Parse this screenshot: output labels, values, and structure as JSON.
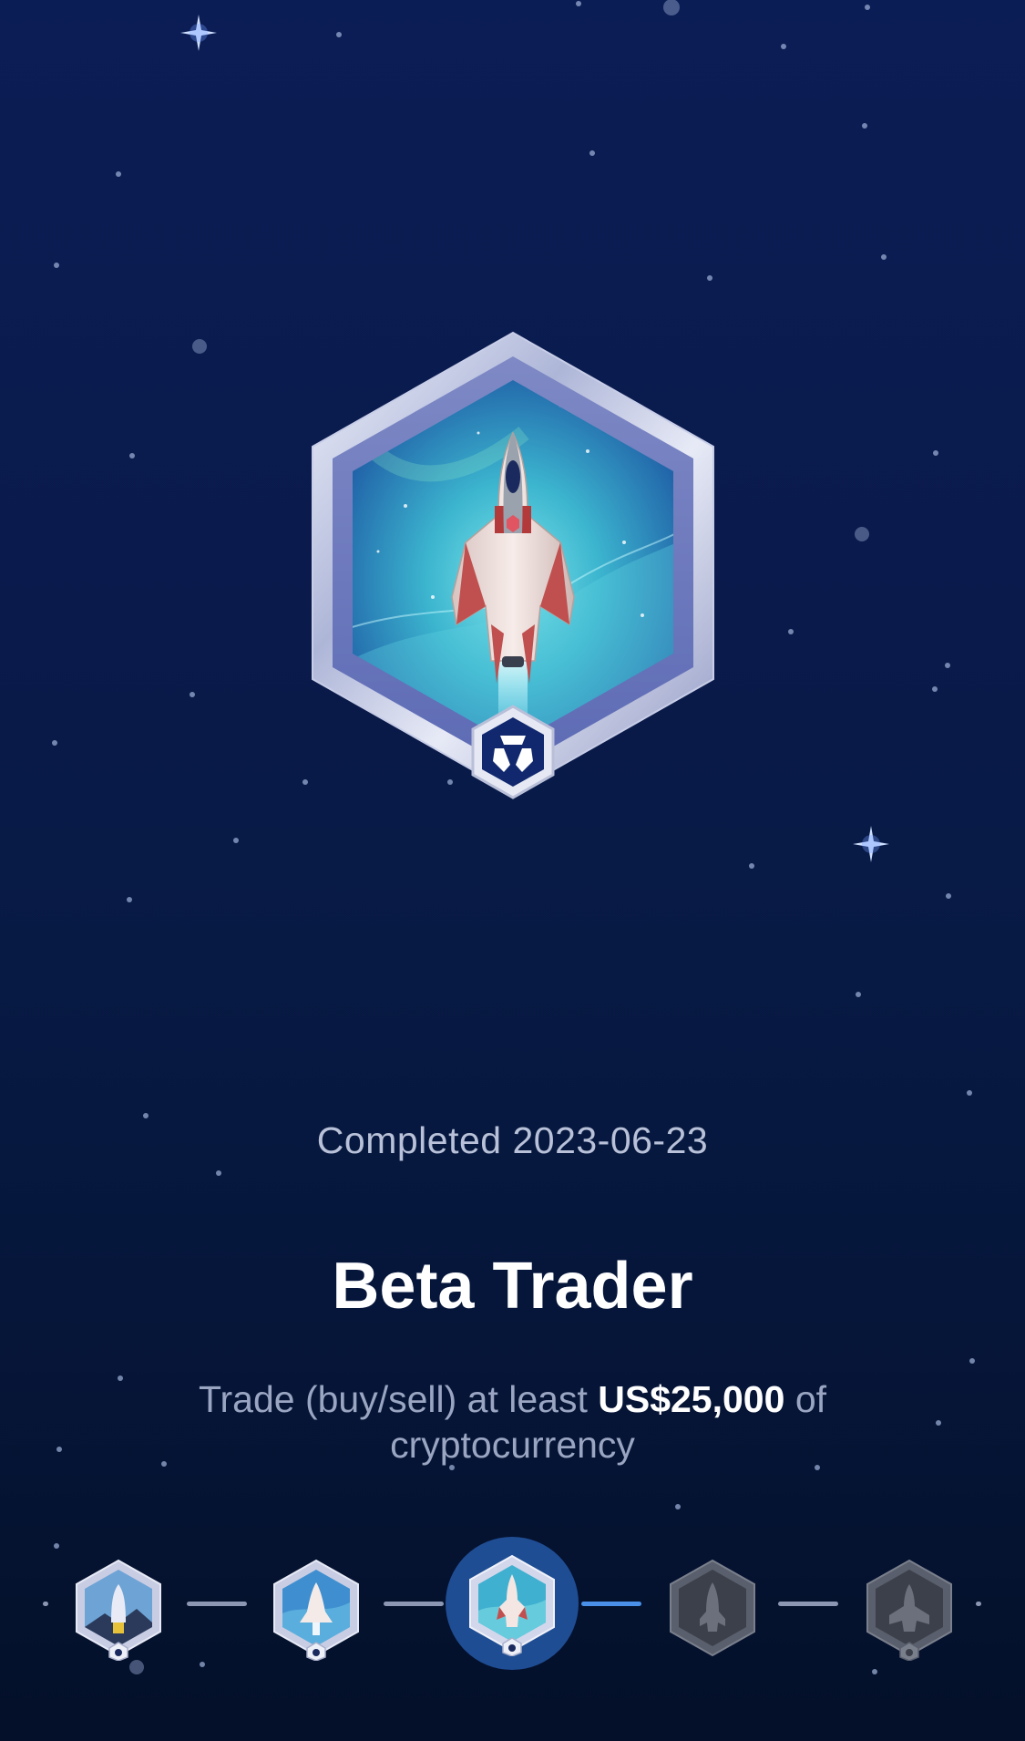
{
  "achievement": {
    "completed_text": "Completed 2023-06-23",
    "title": "Beta Trader",
    "description_prefix": "Trade (buy/sell) at least ",
    "description_amount": "US$25,000",
    "description_suffix": " of cryptocurrency"
  },
  "badge": {
    "icon": "rocket-badge-icon",
    "emblem_icon": "crypto-com-logo-icon"
  },
  "levels": [
    {
      "name": "level-1",
      "state": "unlocked",
      "icon": "rocket-badge-icon"
    },
    {
      "name": "level-2",
      "state": "unlocked",
      "icon": "shuttle-badge-icon"
    },
    {
      "name": "level-3",
      "state": "current",
      "icon": "spaceship-badge-icon"
    },
    {
      "name": "level-4",
      "state": "locked",
      "icon": "locked-rocket-badge-icon"
    },
    {
      "name": "level-5",
      "state": "locked",
      "icon": "locked-starship-badge-icon"
    }
  ],
  "colors": {
    "background_top": "#0b1d55",
    "background_bottom": "#041029",
    "accent": "#4a90e8",
    "current_level_bg": "#1f4d93"
  }
}
